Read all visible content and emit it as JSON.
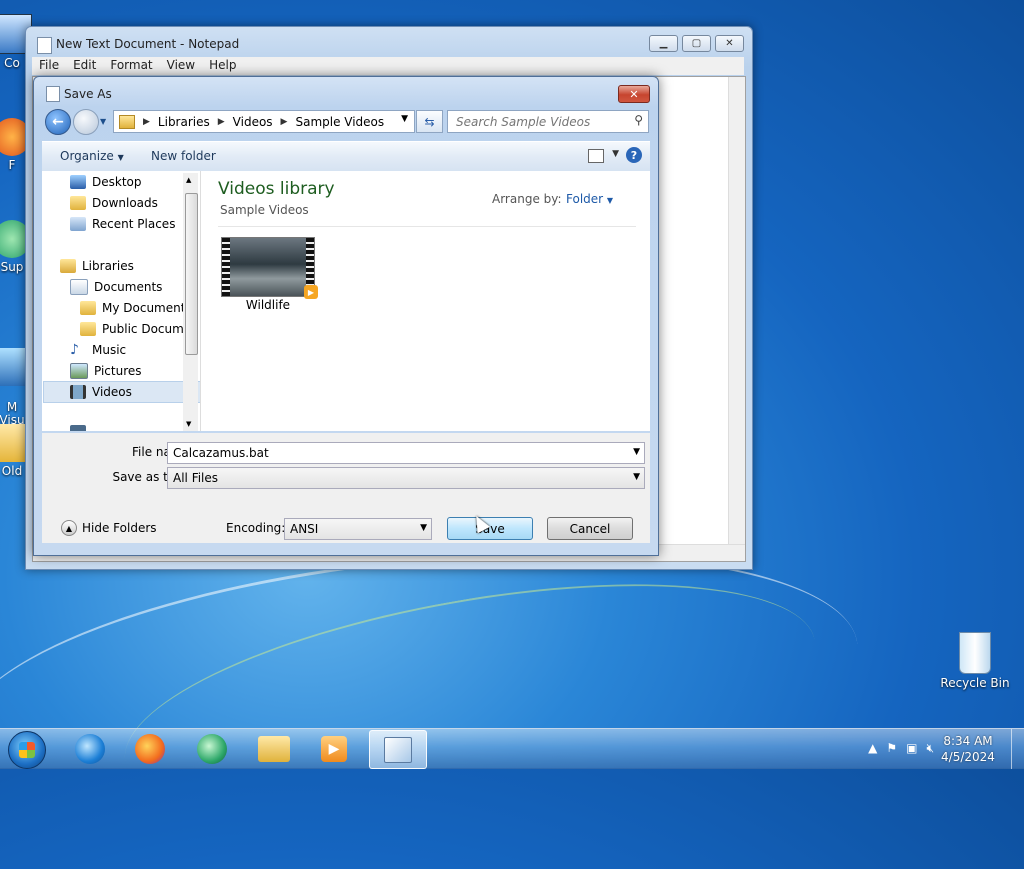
{
  "desktop": {
    "icons": [
      {
        "label": "Co"
      },
      {
        "label": "F"
      },
      {
        "label": "Sup"
      },
      {
        "label": "M\nVisu"
      },
      {
        "label": "Old"
      }
    ],
    "recycle_bin": {
      "label": "Recycle Bin"
    }
  },
  "notepad": {
    "title": "New Text Document - Notepad",
    "menu": [
      "File",
      "Edit",
      "Format",
      "View",
      "Help"
    ]
  },
  "dialog": {
    "title": "Save As",
    "breadcrumb": [
      "Libraries",
      "Videos",
      "Sample Videos"
    ],
    "search_placeholder": "Search Sample Videos",
    "toolbar": {
      "organize": "Organize",
      "new_folder": "New folder"
    },
    "nav_items": [
      {
        "label": "Desktop",
        "icon": "desktop-icon"
      },
      {
        "label": "Downloads",
        "icon": "downloads-folder-icon"
      },
      {
        "label": "Recent Places",
        "icon": "recent-places-icon"
      },
      {
        "label": "Libraries",
        "icon": "libraries-icon"
      },
      {
        "label": "Documents",
        "icon": "documents-icon"
      },
      {
        "label": "My Documents",
        "icon": "folder-icon"
      },
      {
        "label": "Public Docume",
        "icon": "folder-icon"
      },
      {
        "label": "Music",
        "icon": "music-icon"
      },
      {
        "label": "Pictures",
        "icon": "pictures-icon"
      },
      {
        "label": "Videos",
        "icon": "videos-icon",
        "selected": true
      }
    ],
    "library": {
      "title": "Videos library",
      "subtitle": "Sample Videos",
      "arrange_label": "Arrange by:",
      "arrange_value": "Folder",
      "files": [
        {
          "name": "Wildlife"
        }
      ]
    },
    "form": {
      "file_name_label": "File name:",
      "file_name_value": "Calcazamus.bat",
      "save_as_type_label": "Save as type:",
      "save_as_type_value": "All Files",
      "encoding_label": "Encoding:",
      "encoding_value": "ANSI",
      "hide_folders": "Hide Folders",
      "save": "Save",
      "cancel": "Cancel"
    }
  },
  "taskbar": {
    "clock_time": "8:34 AM",
    "clock_date": "4/5/2024"
  },
  "colors": {
    "accent": "#1e5aa8",
    "library_title": "#1e5d20",
    "close_button": "#c7452f"
  }
}
